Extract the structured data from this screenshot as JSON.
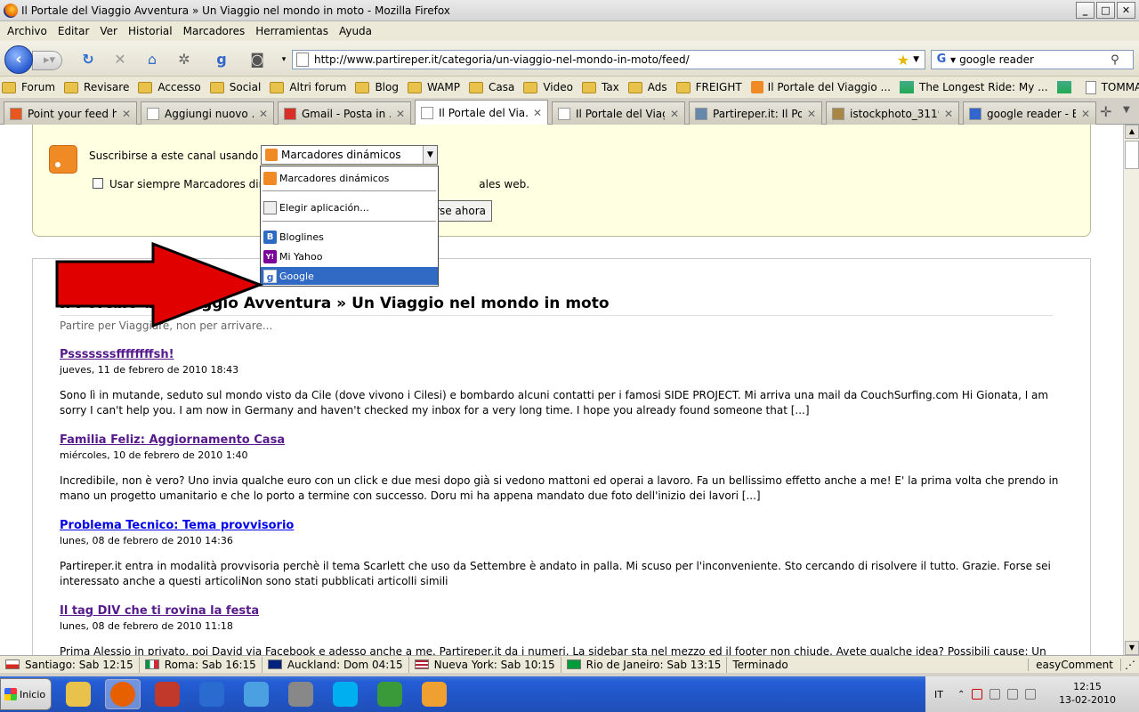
{
  "window": {
    "title": "Il Portale del Viaggio Avventura » Un Viaggio nel mondo in moto - Mozilla Firefox",
    "buttons": {
      "minimize": "_",
      "maximize": "□",
      "close": "✕"
    }
  },
  "menubar": [
    "Archivo",
    "Editar",
    "Ver",
    "Historial",
    "Marcadores",
    "Herramientas",
    "Ayuda"
  ],
  "navbar": {
    "url": "http://www.partireper.it/categoria/un-viaggio-nel-mondo-in-moto/feed/",
    "search_value": "google reader"
  },
  "bookmarks": [
    {
      "label": "Forum",
      "icon": "folder"
    },
    {
      "label": "Revisare",
      "icon": "folder"
    },
    {
      "label": "Accesso",
      "icon": "folder"
    },
    {
      "label": "Social",
      "icon": "folder"
    },
    {
      "label": "Altri forum",
      "icon": "folder"
    },
    {
      "label": "Blog",
      "icon": "folder"
    },
    {
      "label": "WAMP",
      "icon": "folder"
    },
    {
      "label": "Casa",
      "icon": "folder"
    },
    {
      "label": "Video",
      "icon": "folder"
    },
    {
      "label": "Tax",
      "icon": "folder"
    },
    {
      "label": "Ads",
      "icon": "folder"
    },
    {
      "label": "FREIGHT",
      "icon": "folder"
    },
    {
      "label": "Il Portale del Viaggio ...",
      "icon": "rss"
    },
    {
      "label": "The Longest Ride: My ...",
      "icon": "pic"
    },
    {
      "label": "",
      "icon": "pic"
    },
    {
      "label": "TOMMASO PINI",
      "icon": "doc"
    }
  ],
  "tabs": [
    {
      "label": "Point your feed h...",
      "icon_color": "#e8571e",
      "active": false
    },
    {
      "label": "Aggiungi nuovo ...",
      "icon_color": "#ffffff",
      "active": false
    },
    {
      "label": "Gmail - Posta in ...",
      "icon_color": "#d93025",
      "active": false
    },
    {
      "label": "Il Portale del Via...",
      "icon_color": "#ffffff",
      "active": true
    },
    {
      "label": "Il Portale del Viag...",
      "icon_color": "#ffffff",
      "active": false
    },
    {
      "label": "Partireper.it: Il Po...",
      "icon_color": "#6688aa",
      "active": false
    },
    {
      "label": "istockphoto_3119...",
      "icon_color": "#aa8844",
      "active": false
    },
    {
      "label": "google reader - B...",
      "icon_color": "#3366cc",
      "active": false
    }
  ],
  "subscribe": {
    "label": "Suscribirse a este canal usando",
    "selected": "Marcadores dinámicos",
    "always_label": "Usar siempre Marcadores dinámicos para suscribirse a los canales web.",
    "always_visible_left": "Usar siempre Marcadores din",
    "always_visible_right": "ales web.",
    "button_label": "Suscribirse ahora",
    "button_visible": "rse ahora",
    "options": [
      {
        "label": "Marcadores dinámicos",
        "icon": "rss-icon",
        "selected": false
      },
      {
        "label": "Elegir aplicación...",
        "icon": "app-icon",
        "selected": false
      },
      {
        "label": "Bloglines",
        "icon": "bloglines-icon",
        "selected": false
      },
      {
        "label": "Mi Yahoo",
        "icon": "yahoo-icon",
        "selected": false
      },
      {
        "label": "Google",
        "icon": "google-icon",
        "selected": true
      }
    ]
  },
  "blog": {
    "title": "Il Portale del Viaggio Avventura » Un Viaggio nel mondo in moto",
    "title_visible": "Il Portale del Viaggio Avventura » Un Viaggio nel mondo in moto",
    "subtitle": "Partire per Viaggiare, non per arrivare...",
    "posts": [
      {
        "title": "Psssssssffffffffsh!",
        "date": "jueves, 11 de febrero de 2010 18:43",
        "body": "Sono lì in mutande, seduto sul mondo visto da Cile (dove vivono i Cilesi) e bombardo alcuni contatti per i famosi SIDE PROJECT. Mi arriva una mail da CouchSurfing.com Hi Gionata, I am sorry I can't help you. I am now in Germany and haven't checked my inbox for a very long time. I hope you already found someone that [...]",
        "visited": true
      },
      {
        "title": "Familia Feliz: Aggiornamento Casa",
        "date": "miércoles, 10 de febrero de 2010 1:40",
        "body": "Incredibile, non è vero? Uno invia qualche euro con un click e due mesi dopo già si vedono mattoni ed operai a lavoro. Fa un bellissimo effetto anche a me! E' la prima volta che prendo in mano un progetto umanitario e che lo porto a termine con successo. Doru mi ha appena mandato due foto dell'inizio dei lavori [...]",
        "visited": true
      },
      {
        "title": "Problema Tecnico: Tema provvisorio",
        "date": "lunes, 08 de febrero de 2010 14:36",
        "body": "Partireper.it entra in modalità provvisoria perchè il tema Scarlett che uso da Settembre è andato in palla. Mi scuso per l'inconveniente. Sto cercando di risolvere il tutto. Grazie. Forse sei interessato anche a questi articoliNon sono stati pubblicati articolli simili",
        "visited": false
      },
      {
        "title": "Il tag DIV che ti rovina la festa",
        "date": "lunes, 08 de febrero de 2010 11:18",
        "body": "Prima Alessio in privato, poi David via Facebook e adesso anche a me. Partireper.it da i numeri. La sidebar sta nel mezzo ed il footer non chiude. Avete qualche idea? Possibili cause: Un <div>",
        "visited": true
      }
    ]
  },
  "statusbar": {
    "clocks": [
      {
        "label": "Santiago: Sab 12:15",
        "flag": "chile-flag-icon"
      },
      {
        "label": "Roma: Sab 16:15",
        "flag": "italy-flag-icon"
      },
      {
        "label": "Auckland: Dom 04:15",
        "flag": "nz-flag-icon"
      },
      {
        "label": "Nueva York: Sab 10:15",
        "flag": "usa-flag-icon"
      },
      {
        "label": "Rio de Janeiro: Sab 13:15",
        "flag": "brazil-flag-icon"
      }
    ],
    "status": "Terminado",
    "easy_comment": "easyComment"
  },
  "taskbar": {
    "start": "Inicio",
    "apps": [
      "explorer-icon",
      "firefox-icon",
      "filezilla-icon",
      "thunderbird-icon",
      "kite-icon",
      "webcam-icon",
      "skype-icon",
      "utorrent-icon",
      "paint-icon"
    ],
    "lang": "IT",
    "time": "12:15",
    "date": "13-02-2010"
  },
  "colors": {
    "accent": "#316ac5",
    "visited_link": "#551a8b",
    "link": "#0000ee",
    "arrow": "#e00000",
    "feed_bg": "#ffffe1"
  }
}
